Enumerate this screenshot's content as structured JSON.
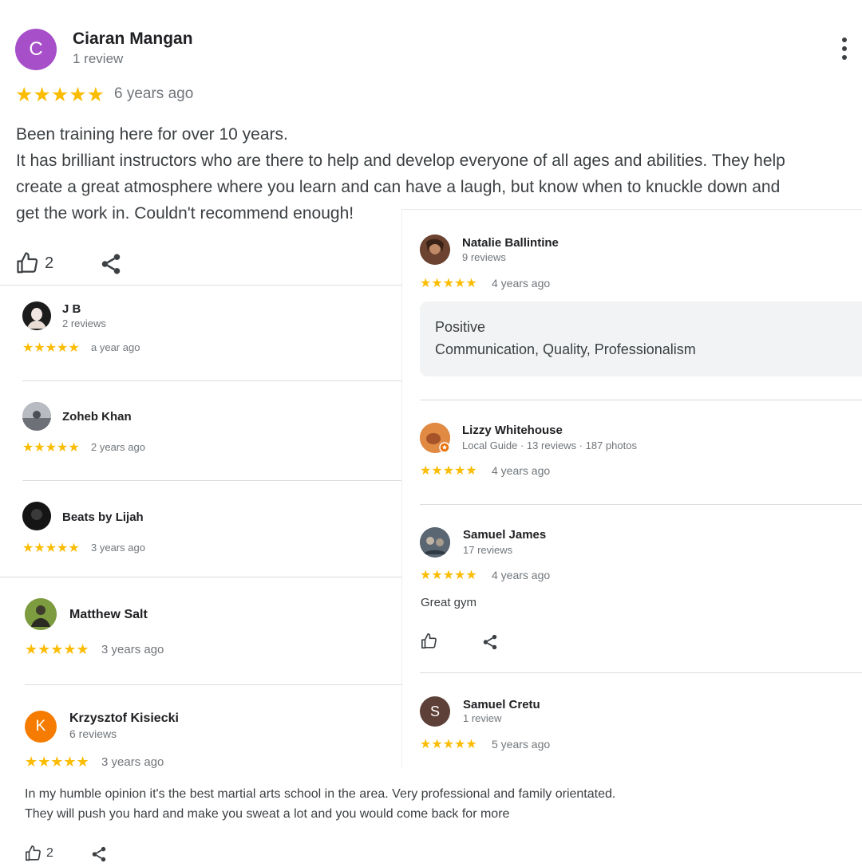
{
  "main_review": {
    "avatar_letter": "C",
    "avatar_color": "#a64fc9",
    "name": "Ciaran Mangan",
    "meta": "1 review",
    "stars": "★★★★★",
    "date": "6 years ago",
    "text_line1": "Been training here for over 10 years.",
    "text_line2": "It has brilliant instructors who are there to help and develop everyone of all ages and abilities. They help",
    "text_line3": "create a great atmosphere where you learn and can have a laugh, but know when to knuckle down and",
    "text_line4": "get the work in. Couldn't recommend enough!",
    "likes": "2"
  },
  "left_reviews": [
    {
      "name": "J B",
      "meta": "2 reviews",
      "stars": "★★★★★",
      "date": "a year ago"
    },
    {
      "name": "Zoheb Khan",
      "stars": "★★★★★",
      "date": "2 years ago"
    },
    {
      "name": "Beats by Lijah",
      "stars": "★★★★★",
      "date": "3 years ago"
    },
    {
      "name": "Matthew Salt",
      "stars": "★★★★★",
      "date": "3 years ago"
    },
    {
      "avatar_letter": "K",
      "avatar_color": "#f57c00",
      "name": "Krzysztof Kisiecki",
      "meta": "6 reviews",
      "stars": "★★★★★",
      "date": "3 years ago",
      "text_line1": "In my humble opinion it's the best martial arts school in the area. Very professional and family orientated.",
      "text_line2": "They will push you hard and make you sweat a lot and you would come back for more",
      "likes": "2"
    }
  ],
  "right_reviews": [
    {
      "name": "Natalie Ballintine",
      "meta": "9 reviews",
      "stars": "★★★★★",
      "date": "4 years ago",
      "chip_title": "Positive",
      "chip_text": "Communication, Quality, Professionalism"
    },
    {
      "name": "Lizzy Whitehouse",
      "meta": "Local Guide · 13 reviews · 187 photos",
      "stars": "★★★★★",
      "date": "4 years ago"
    },
    {
      "name": "Samuel James",
      "meta": "17 reviews",
      "stars": "★★★★★",
      "date": "4 years ago",
      "text": "Great gym"
    },
    {
      "avatar_letter": "S",
      "avatar_color": "#5d4037",
      "name": "Samuel Cretu",
      "meta": "1 review",
      "stars": "★★★★★",
      "date": "5 years ago"
    }
  ],
  "colors": {
    "star": "#fbbc04",
    "divider": "#dadce0",
    "icon": "#5f6368"
  }
}
